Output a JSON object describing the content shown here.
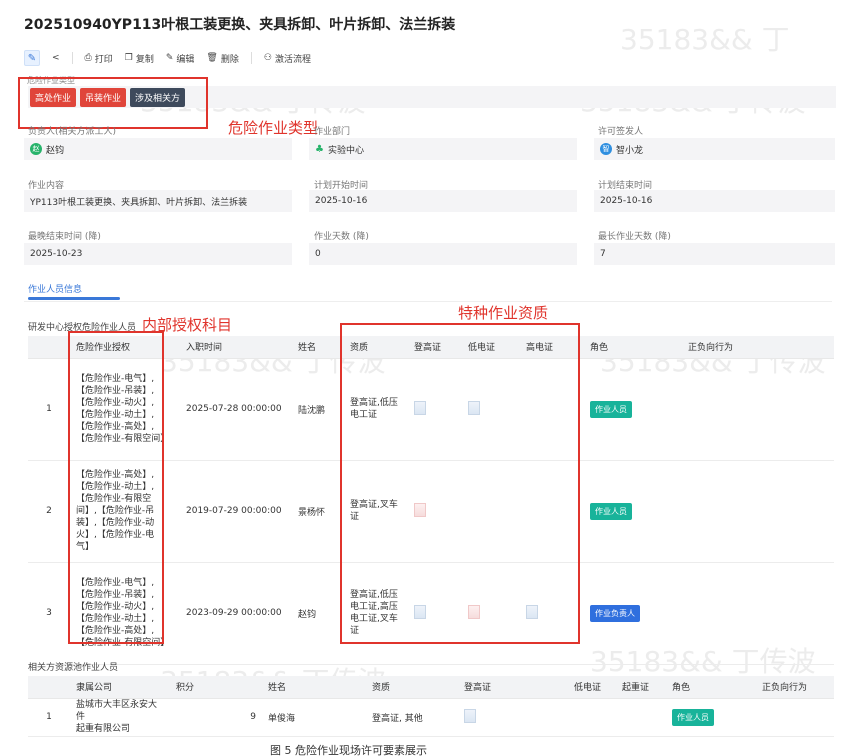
{
  "page_title": "202510940YP113叶根工装更换、夹具拆卸、叶片拆卸、法兰拆装",
  "toolbar": {
    "items": [
      {
        "name": "share-icon",
        "label": "<"
      },
      {
        "name": "print",
        "label": "打印"
      },
      {
        "name": "copy",
        "label": "复制"
      },
      {
        "name": "edit",
        "label": "编辑"
      },
      {
        "name": "delete",
        "label": "删除"
      },
      {
        "name": "activate",
        "label": "激活流程"
      }
    ]
  },
  "hazard": {
    "label": "危险作业类型",
    "tags": [
      {
        "label": "高处作业",
        "color": "#e0453a"
      },
      {
        "label": "吊装作业",
        "color": "#e0453a"
      },
      {
        "label": "涉及相关方",
        "color": "#3e4a5c"
      }
    ]
  },
  "annotations": {
    "hazard_type": "危险作业类型",
    "internal_auth": "内部授权科目",
    "special_qual": "特种作业资质"
  },
  "fields": {
    "responsible_label": "负责人(相关方派工人)",
    "responsible_value": "赵钧",
    "dept_label": "作业部门",
    "dept_value": "实验中心",
    "signer_label": "许可签发人",
    "signer_value": "智小龙",
    "content_label": "作业内容",
    "content_value": "YP113叶根工装更换、夹具拆卸、叶片拆卸、法兰拆装",
    "plan_start_label": "计划开始时间",
    "plan_start_value": "2025-10-16",
    "plan_end_label": "计划结束时间",
    "plan_end_value": "2025-10-16",
    "latest_end_label": "最晚结束时间 (降)",
    "latest_end_value": "2025-10-23",
    "work_days_label": "作业天数 (降)",
    "work_days_value": "0",
    "max_days_label": "最长作业天数 (降)",
    "max_days_value": "7"
  },
  "tabs": {
    "active": "作业人员信息"
  },
  "table1": {
    "section_title": "研发中心授权危险作业人员",
    "headers": [
      "",
      "危险作业授权",
      "入职时间",
      "姓名",
      "资质",
      "登高证",
      "低电证",
      "高电证",
      "角色",
      "正负向行为"
    ],
    "rows": [
      {
        "index": "1",
        "auth": "【危险作业-电气】,\n【危险作业-吊装】,\n【危险作业-动火】,\n【危险作业-动土】,\n【危险作业-高处】,\n【危险作业-有限空间】",
        "hire_date": "2025-07-28 00:00:00",
        "name": "陆沈鹏",
        "qual": "登高证,低压\n电工证",
        "role": "作业人员",
        "role_color": "#18b39a"
      },
      {
        "index": "2",
        "auth": "【危险作业-高处】,\n【危险作业-动土】,\n【危险作业-有限空\n间】,【危险作业-吊\n装】,【危险作业-动\n火】,【危险作业-电\n气】",
        "hire_date": "2019-07-29 00:00:00",
        "name": "景杨怀",
        "qual": "登高证,叉车\n证",
        "role": "作业人员",
        "role_color": "#18b39a"
      },
      {
        "index": "3",
        "auth": "【危险作业-电气】,\n【危险作业-吊装】,\n【危险作业-动火】,\n【危险作业-动土】,\n【危险作业-高处】,\n【危险作业-有限空间】",
        "hire_date": "2023-09-29 00:00:00",
        "name": "赵钧",
        "qual": "登高证,低压\n电工证,高压\n电工证,叉车\n证",
        "role": "作业负责人",
        "role_color": "#2f6fde"
      }
    ]
  },
  "table2": {
    "section_title": "相关方资源池作业人员",
    "headers": [
      "",
      "隶属公司",
      "积分",
      "姓名",
      "资质",
      "登高证",
      "低电证",
      "起重证",
      "角色",
      "正负向行为"
    ],
    "rows": [
      {
        "index": "1",
        "company": "盐城市大丰区永安大件\n起重有限公司",
        "score": "9",
        "name": "单俊海",
        "qual": "登高证, 其他",
        "role": "作业人员",
        "role_color": "#18b39a"
      }
    ]
  },
  "caption": "图 5  危险作业现场许可要素展示"
}
